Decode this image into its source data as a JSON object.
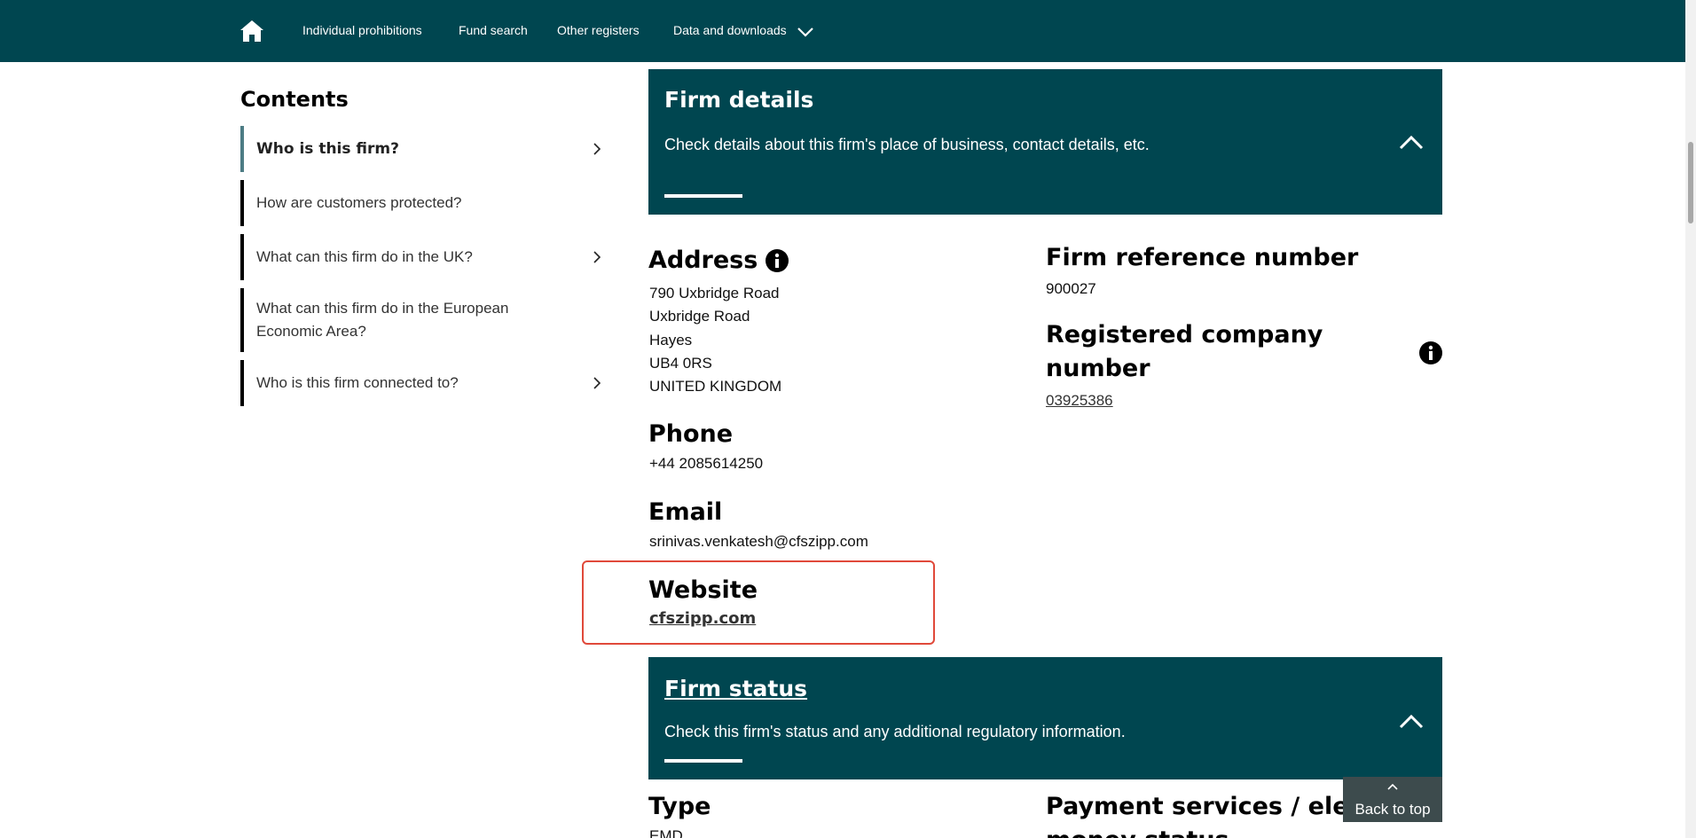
{
  "nav": {
    "items": [
      "Individual prohibitions",
      "Fund search",
      "Other registers",
      "Data and downloads"
    ],
    "home_icon": "home-icon",
    "dropdown_icon": "chevron-down-icon"
  },
  "sidebar": {
    "title": "Contents",
    "items": [
      {
        "label": "Who is this firm?",
        "active": true,
        "has_chevron": true
      },
      {
        "label": "How are customers protected?",
        "active": false,
        "has_chevron": false
      },
      {
        "label": "What can this firm do in the UK?",
        "active": false,
        "has_chevron": true
      },
      {
        "label": "What can this firm do in the European Economic Area?",
        "active": false,
        "has_chevron": false
      },
      {
        "label": "Who is this firm connected to?",
        "active": false,
        "has_chevron": true
      }
    ]
  },
  "firm_details": {
    "title": "Firm details",
    "description": "Check details about this firm's place of business, contact details, etc."
  },
  "address": {
    "label": "Address",
    "lines": [
      "790 Uxbridge Road",
      "Uxbridge Road",
      "Hayes",
      "UB4 0RS",
      "UNITED KINGDOM"
    ]
  },
  "phone": {
    "label": "Phone",
    "value": "+44 2085614250"
  },
  "email": {
    "label": "Email",
    "value": "srinivas.venkatesh@cfszipp.com"
  },
  "website": {
    "label": "Website",
    "value": "cfszipp.com"
  },
  "frn": {
    "label": "Firm reference number",
    "value": "900027"
  },
  "company_number": {
    "label_line1": "Registered company",
    "label_line2": "number",
    "value": "03925386"
  },
  "firm_status": {
    "title": "Firm status",
    "description": "Check this firm's status and any additional regulatory information."
  },
  "type": {
    "label": "Type",
    "value": "EMD"
  },
  "payment_status": {
    "label_line1": "Payment services / ele",
    "label_line2": "money status"
  },
  "back_to_top": {
    "label": "Back to top"
  },
  "colors": {
    "nav_bg": "#004650",
    "accordion_bg": "#004650",
    "highlight": "#e0493a",
    "back_to_top_bg": "#3d4b4d"
  }
}
